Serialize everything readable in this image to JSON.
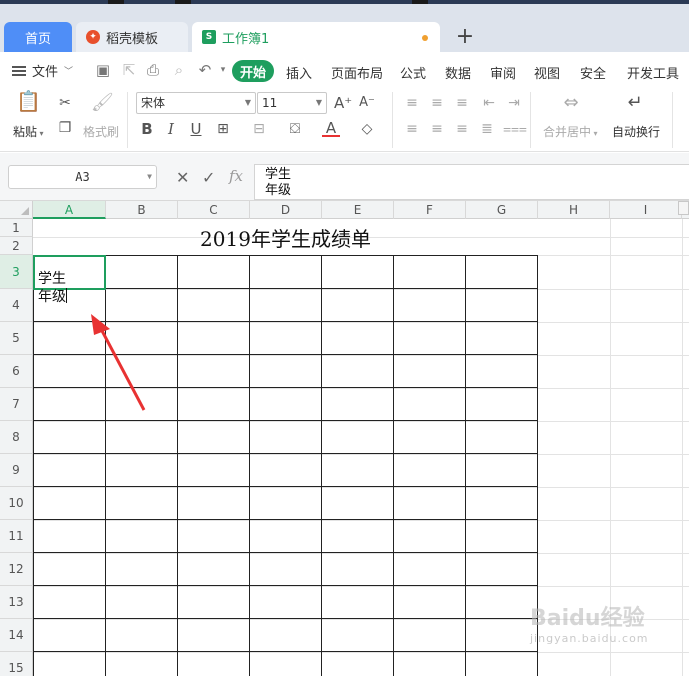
{
  "tabs": {
    "home": "首页",
    "templates": "稻壳模板",
    "workbook": "工作簿1",
    "new_tab": "+"
  },
  "menu": {
    "file": "文件",
    "items": [
      "开始",
      "插入",
      "页面布局",
      "公式",
      "数据",
      "审阅",
      "视图",
      "安全",
      "开发工具"
    ]
  },
  "ribbon": {
    "paste": "粘贴",
    "format_painter": "格式刷",
    "font_name": "宋体",
    "font_size": "11",
    "merge_center": "合并居中",
    "wrap_text": "自动换行",
    "bold": "B",
    "italic": "I",
    "underline": "U",
    "font_color": "A"
  },
  "formula_bar": {
    "cell_ref": "A3",
    "fx": "fx",
    "content_line1": "学生",
    "content_line2": "年级"
  },
  "sheet": {
    "columns": [
      "A",
      "B",
      "C",
      "D",
      "E",
      "F",
      "G",
      "H",
      "I"
    ],
    "rows": [
      "1",
      "2",
      "3",
      "4",
      "5",
      "6",
      "7",
      "8",
      "9",
      "10",
      "11",
      "12",
      "13",
      "14",
      "15"
    ],
    "title": "2019年学生成绩单",
    "active_cell": "A3",
    "active_cell_line1": "学生",
    "active_cell_line2": "年级"
  },
  "colors": {
    "accent": "#1e9e5e",
    "home_tab": "#4f8ef7",
    "arrow": "#e83232"
  },
  "watermark": {
    "text": "Bai",
    "paw": "du",
    "suffix": "经验",
    "sub": "jingyan.baidu.com"
  }
}
